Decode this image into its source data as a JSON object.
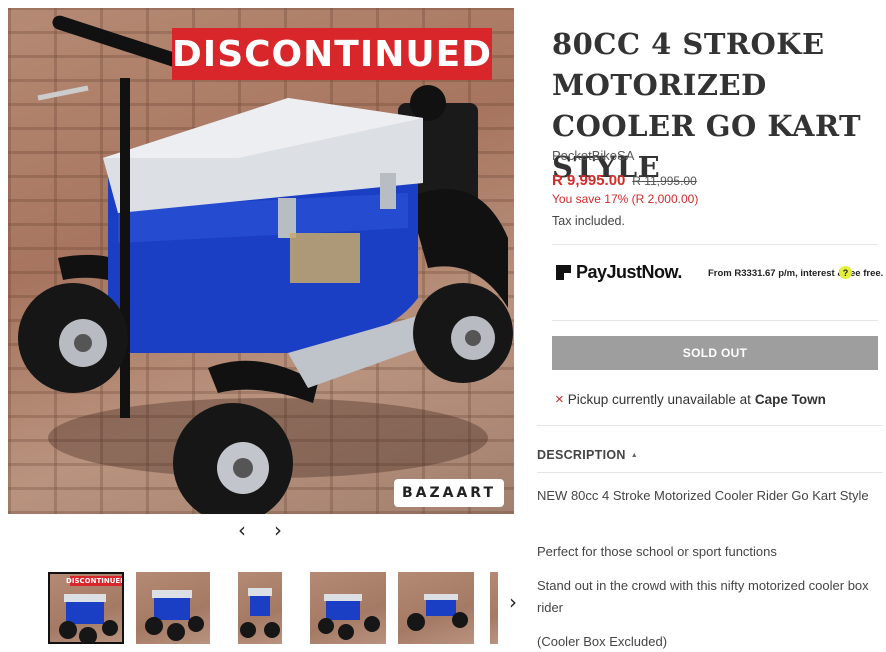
{
  "product": {
    "title": "80CC 4 STROKE MOTORIZED COOLER GO KART STYLE",
    "vendor": "PocketBikeSA",
    "price": "R 9,995.00",
    "compare_price": "R 11,995.00",
    "saving": "You save 17% (R 2,000.00)",
    "tax_note": "Tax included."
  },
  "image": {
    "banner": "DISCONTINUED",
    "watermark": "BAZAART",
    "thumb_banner": "DISCONTINUED"
  },
  "gallery": {
    "prev_glyph": "‹",
    "next_glyph": "›",
    "thumb_next_glyph": "›"
  },
  "payjustnow": {
    "brand": "PayJustNow.",
    "offer": "From R3331.67 p/m, interest & fee free.",
    "help": "?"
  },
  "buy": {
    "button": "SOLD OUT"
  },
  "pickup": {
    "icon": "×",
    "text": "Pickup currently unavailable at",
    "location": "Cape Town"
  },
  "description": {
    "header": "DESCRIPTION",
    "caret": "▲",
    "paragraphs": [
      "NEW 80cc 4 Stroke Motorized Cooler Rider Go Kart Style",
      "Perfect for those school or sport functions",
      "Stand out in the crowd with this nifty motorized cooler box rider",
      "(Cooler Box Excluded)"
    ]
  },
  "colors": {
    "sale": "#d12c2c",
    "banner": "#d9262b",
    "sold_out_bg": "#9e9e9e",
    "cooler_blue": "#1a3fc4"
  }
}
